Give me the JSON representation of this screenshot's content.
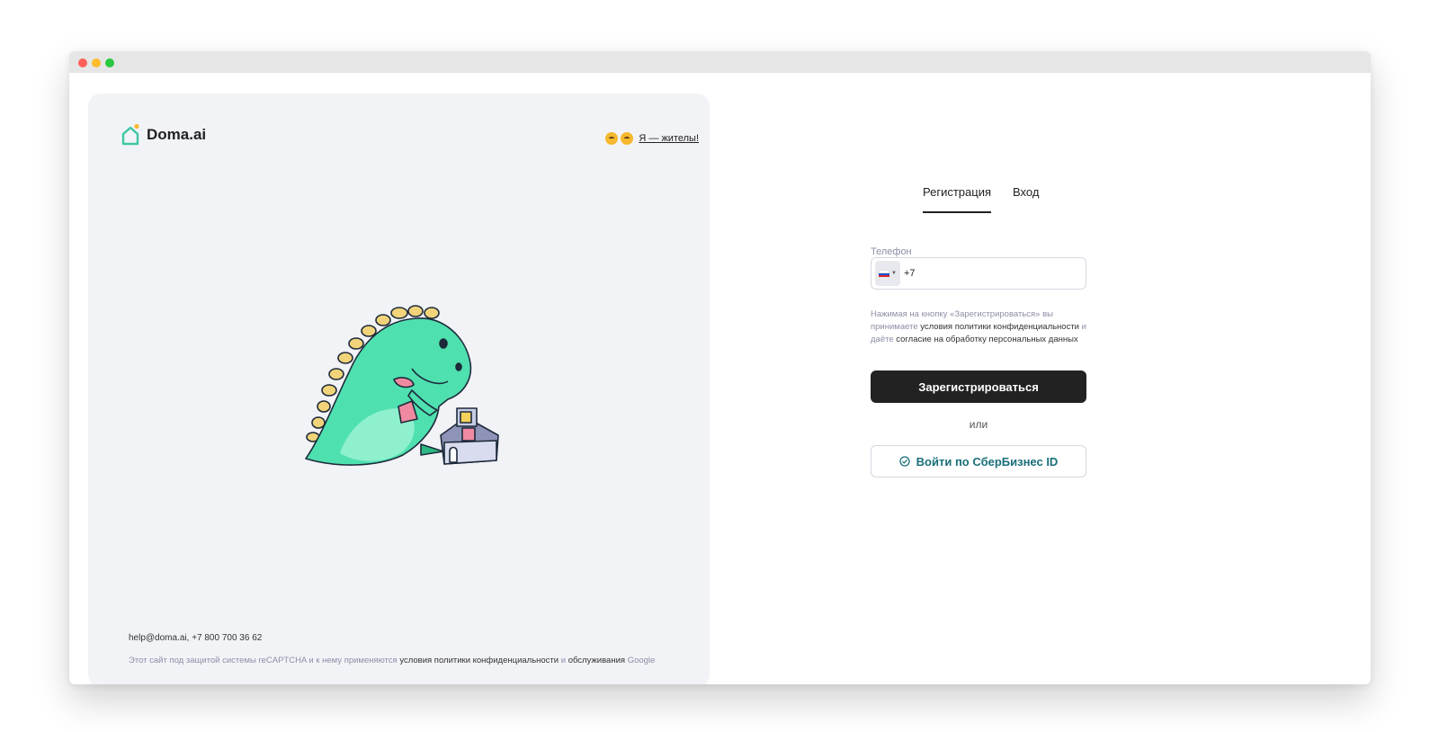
{
  "brand": {
    "name": "Doma.ai"
  },
  "resident": {
    "link_label": "Я — жителы!"
  },
  "tabs": [
    {
      "label": "Регистрация",
      "active": true
    },
    {
      "label": "Вход",
      "active": false
    }
  ],
  "phone": {
    "label": "Телефон",
    "value": "+7",
    "country": "ru-flag-icon"
  },
  "consent": {
    "part1": "Нажимая на кнопку «Зарегистрироваться» вы",
    "part2": "принимаете",
    "link1": "условия политики конфиденциальности",
    "part3": "и даёте",
    "link2": "согласие на обработку персональных данных"
  },
  "actions": {
    "register_label": "Зарегистрироваться",
    "or_label": "или",
    "sber_label": "Войти по СберБизнес ID"
  },
  "footer": {
    "contact": "help@doma.ai, +7 800 700 36 62",
    "recaptcha_prefix": "Этот сайт под защитой системы reCAPTCHA и к нему применяются",
    "policy_link": "условия политики конфиденциальности",
    "and": "и",
    "service_link": "обслуживания",
    "google": "Google"
  },
  "colors": {
    "accent_dark": "#222222",
    "sber_text": "#1a6f7a",
    "muted_text": "#8c8fa6",
    "panel_bg": "#f2f3f7",
    "dino": "#4fe0b0"
  }
}
